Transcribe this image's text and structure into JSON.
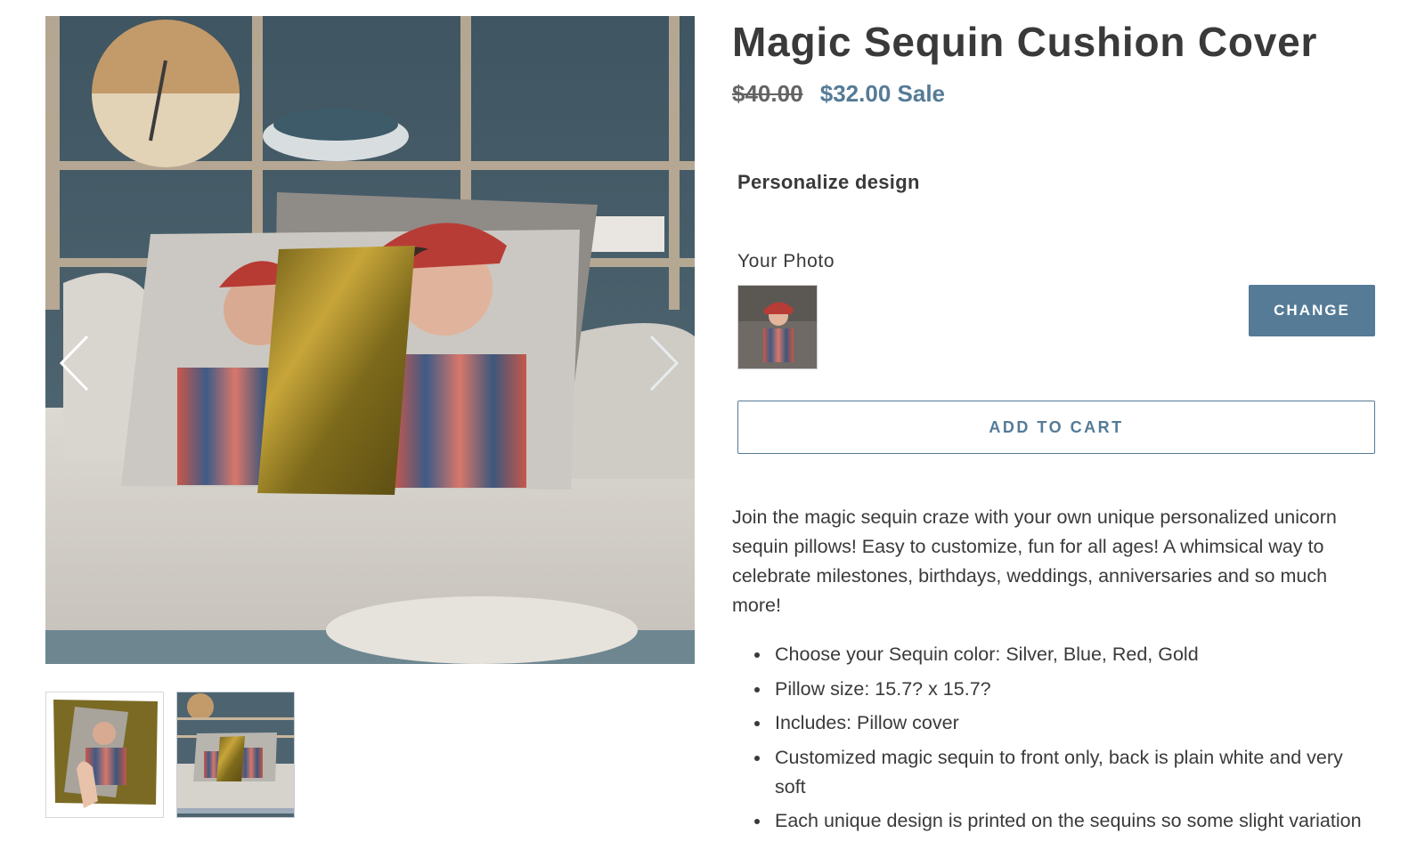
{
  "product": {
    "title": "Magic Sequin Cushion Cover",
    "price_original": "$40.00",
    "price_sale": "$32.00 Sale"
  },
  "personalize": {
    "heading": "Personalize design",
    "photo_label": "Your Photo",
    "change_label": "CHANGE"
  },
  "cart": {
    "add_label": "ADD TO CART"
  },
  "description": {
    "paragraph": "Join the magic sequin craze with your own unique personalized unicorn sequin pillows! Easy to customize, fun for all ages! A whimsical way to celebrate milestones, birthdays, weddings, anniversaries and so much more!",
    "bullets": [
      "Choose your Sequin color: Silver, Blue, Red, Gold",
      "Pillow size: 15.7? x 15.7?",
      "Includes: Pillow cover",
      "Customized magic sequin to front only, back is plain white and very soft",
      "Each unique design is printed on the sequins so some slight variation"
    ]
  },
  "gallery": {
    "main_image": "product-photo-sequin-pillows-on-sofa",
    "thumbnails": [
      "sequin-pillow-hand-thumbnail",
      "sofa-scene-thumbnail"
    ],
    "prev_icon": "chevron-left-icon",
    "next_icon": "chevron-right-icon"
  },
  "colors": {
    "accent": "#557b97",
    "text": "#3a3a3a",
    "strike": "#646464",
    "sequin_gold": "#8a7420"
  }
}
